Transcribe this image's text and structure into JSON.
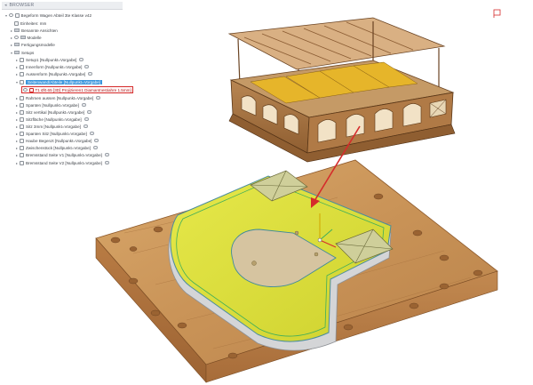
{
  "browser": {
    "title": "BROWSER",
    "document_label": "Begeform Wagen Abteil 3te Klasse v42",
    "items": [
      {
        "label": "Einheiten: mm"
      },
      {
        "label": "Benannte Ansichten"
      },
      {
        "label": "Modelle"
      },
      {
        "label": "Fertigungsmodelle"
      },
      {
        "label": "Setups"
      },
      {
        "label": "Setup1 [Nullpunkt=Vorgabe]"
      },
      {
        "label": "Innenform [Nullpunkt=Vorgabe]"
      },
      {
        "label": "Aussenform [Nullpunkt=Vorgabe]"
      },
      {
        "label": "Seitenwand/Abteile [Nullpunkt=Vorgabe]"
      },
      {
        "label": "T1 Ø0.65 [3D] Projizieren1 Diamantnestiahre 1.5mm]"
      },
      {
        "label": "Rahmen aussen [Nullpunkt=Vorgabe]"
      },
      {
        "label": "Spanten [Nullpunkt=Vorgabe]"
      },
      {
        "label": "Sitz vertikal [Nullpunkt=Vorgabe]"
      },
      {
        "label": "Sitzfläche [Nullpunkt=Vorgabe]"
      },
      {
        "label": "Sitz 3mm [Nullpunkt=Vorgabe]"
      },
      {
        "label": "Spanten Sitz [Nullpunkt=Vorgabe]"
      },
      {
        "label": "Haube Begenzt [Nullpunkt=Vorgabe]"
      },
      {
        "label": "Zwischenstück [Nullpunkt=Vorgabe]"
      },
      {
        "label": "Bremsstand Seite V1 [Nullpunkt=Vorgabe]"
      },
      {
        "label": "Bremsstand Seite V2 [Nullpunkt=Vorgabe]"
      }
    ]
  },
  "colors": {
    "selection": "#3a96dd",
    "highlight": "#d52b2b",
    "wood": "#c8935a",
    "model_yellow": "#dfe23c",
    "tool_path_green": "#3fae5a"
  }
}
